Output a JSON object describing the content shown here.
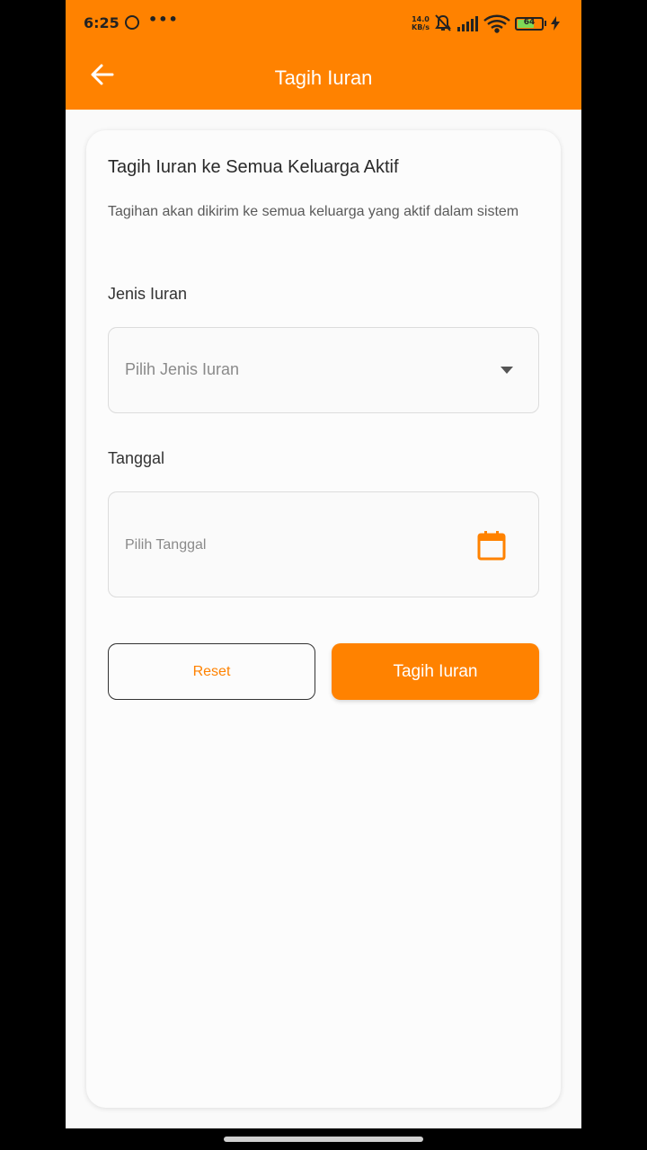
{
  "status_bar": {
    "time": "6:25",
    "dots": "•••",
    "speed_value": "14.0",
    "speed_unit": "KB/s",
    "battery": "64"
  },
  "app_bar": {
    "title": "Tagih Iuran",
    "back_icon": "arrow-left-icon"
  },
  "form": {
    "title": "Tagih Iuran ke Semua Keluarga Aktif",
    "description": "Tagihan akan dikirim ke semua keluarga yang aktif dalam sistem",
    "jenis_label": "Jenis Iuran",
    "jenis_placeholder": "Pilih Jenis Iuran",
    "tanggal_label": "Tanggal",
    "tanggal_placeholder": "Pilih Tanggal",
    "reset_label": "Reset",
    "submit_label": "Tagih Iuran"
  },
  "colors": {
    "accent": "#ff8200",
    "background": "#fafafa"
  }
}
